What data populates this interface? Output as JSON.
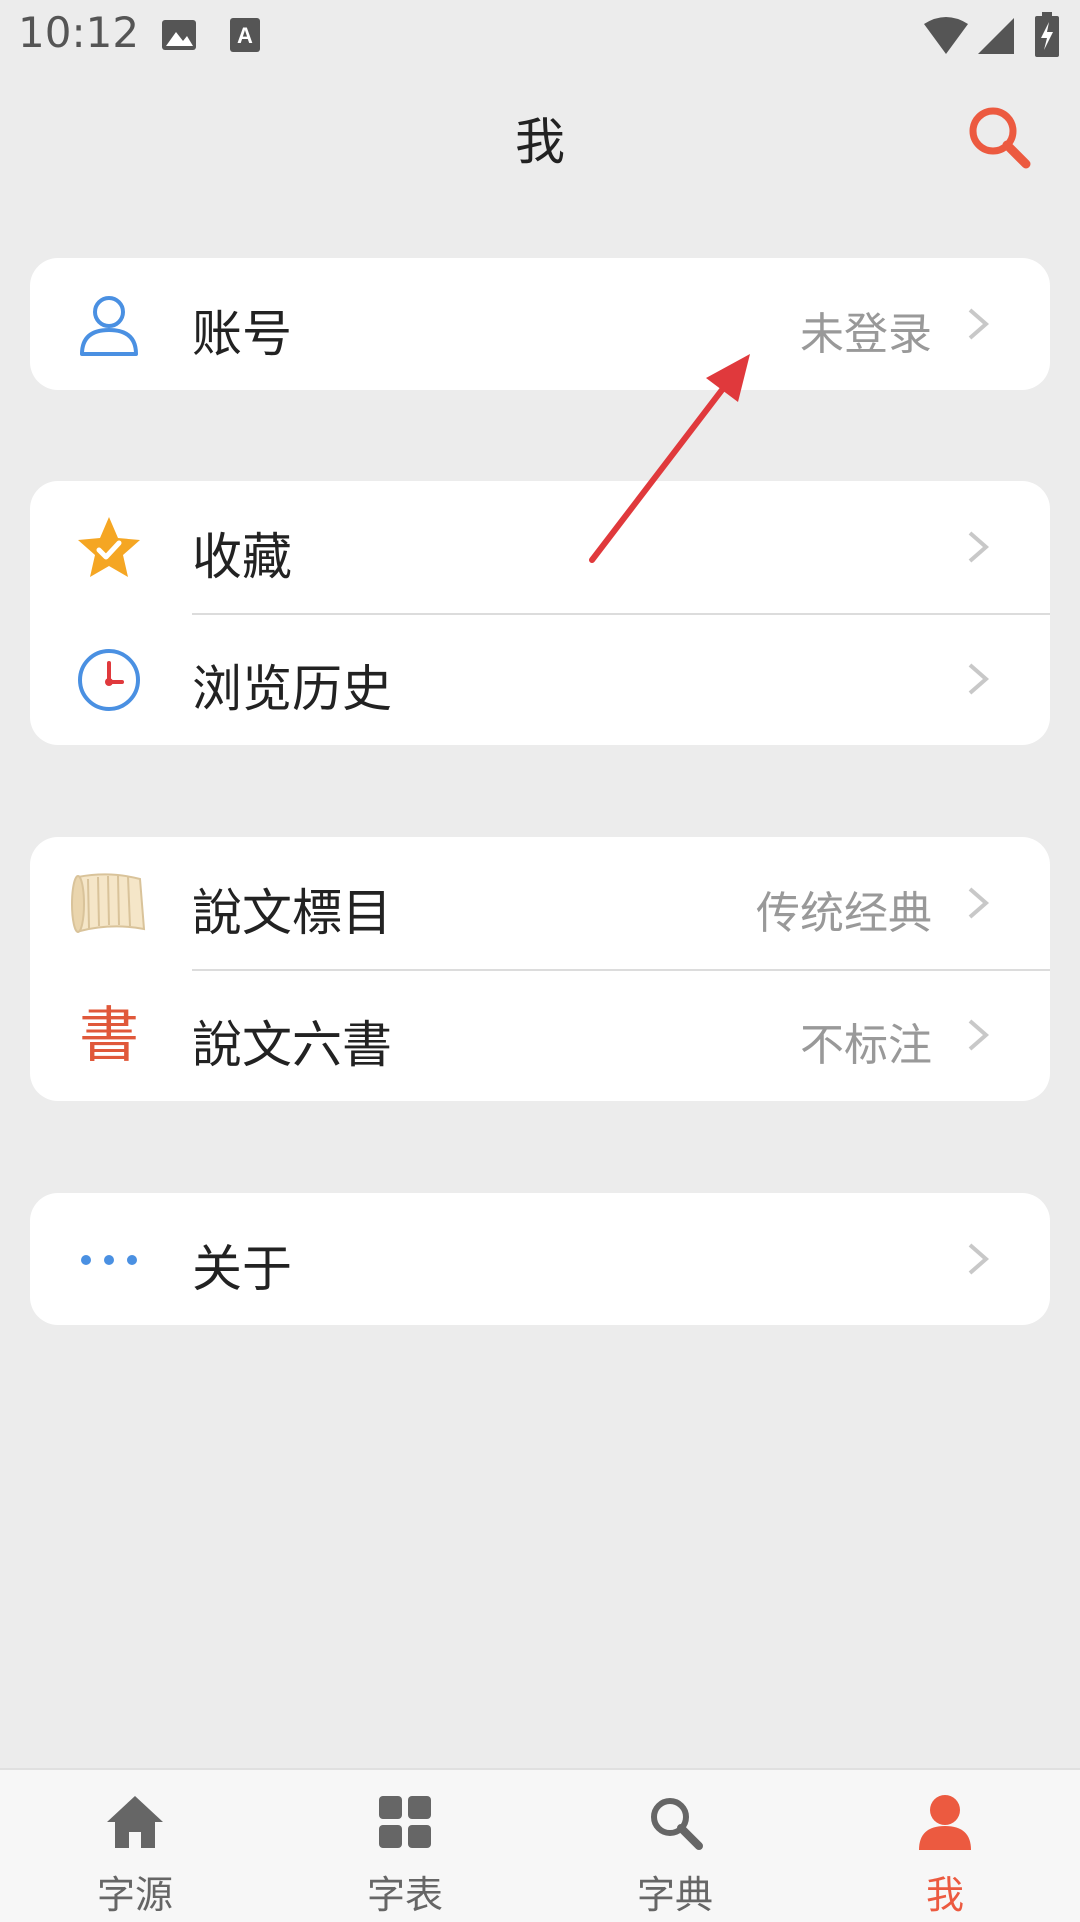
{
  "status": {
    "time": "10:12"
  },
  "header": {
    "title": "我",
    "search_icon": "search-icon"
  },
  "colors": {
    "accent": "#ec5a40",
    "blue": "#4a90e2",
    "star": "#f5a623",
    "annotation_arrow": "#e0393c"
  },
  "groups": [
    {
      "items": [
        {
          "label": "账号",
          "value": "未登录",
          "icon": "user-icon"
        }
      ]
    },
    {
      "items": [
        {
          "label": "收藏",
          "value": "",
          "icon": "star-check-icon"
        },
        {
          "label": "浏览历史",
          "value": "",
          "icon": "clock-icon"
        }
      ]
    },
    {
      "items": [
        {
          "label": "說文標目",
          "value": "传统经典",
          "icon": "scroll-icon"
        },
        {
          "label": "說文六書",
          "value": "不标注",
          "icon": "seal-character-icon",
          "icon_text": "書"
        }
      ]
    },
    {
      "items": [
        {
          "label": "关于",
          "value": "",
          "icon": "more-dots-icon"
        }
      ]
    }
  ],
  "tabbar": {
    "tabs": [
      {
        "label": "字源",
        "icon": "home-icon",
        "active": false
      },
      {
        "label": "字表",
        "icon": "grid-icon",
        "active": false
      },
      {
        "label": "字典",
        "icon": "search-icon",
        "active": false
      },
      {
        "label": "我",
        "icon": "person-icon",
        "active": true
      }
    ]
  }
}
